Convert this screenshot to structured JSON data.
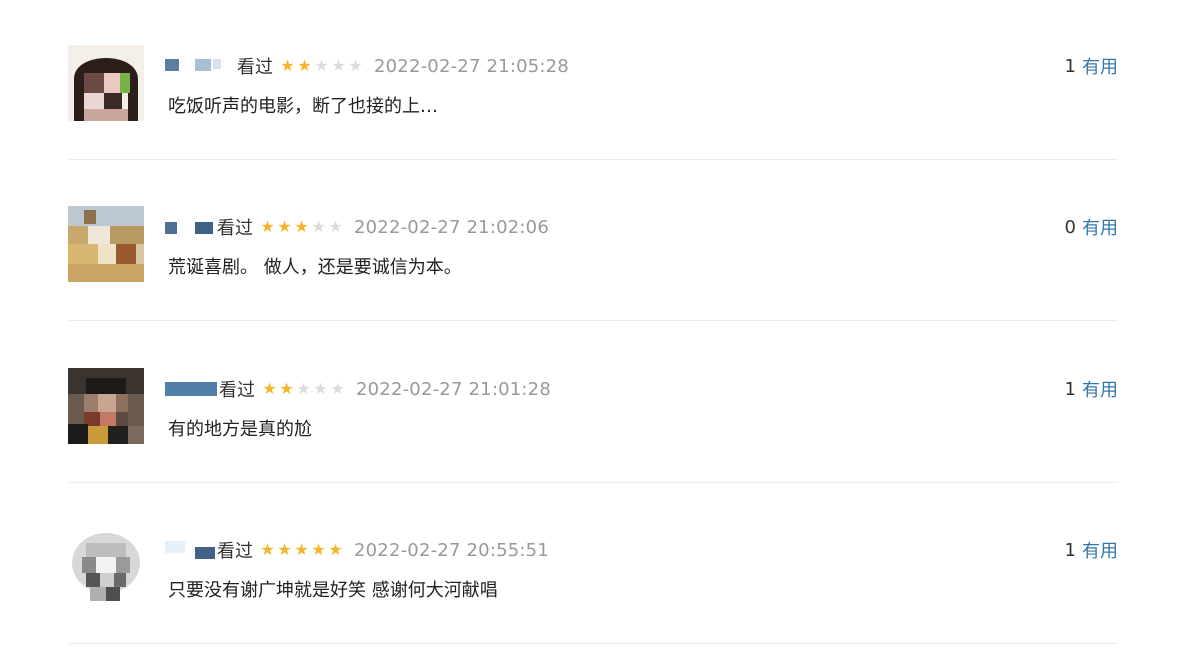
{
  "comments": [
    {
      "status": "看过",
      "rating": 2,
      "time": "2022-02-27 21:05:28",
      "votes": "1",
      "vote_label": "有用",
      "text": "吃饭听声的电影，断了也接的上…"
    },
    {
      "status": "看过",
      "rating": 3,
      "time": "2022-02-27 21:02:06",
      "votes": "0",
      "vote_label": "有用",
      "text": "荒诞喜剧。 做人，还是要诚信为本。"
    },
    {
      "status": "看过",
      "rating": 2,
      "time": "2022-02-27 21:01:28",
      "votes": "1",
      "vote_label": "有用",
      "text": "有的地方是真的尬"
    },
    {
      "status": "看过",
      "rating": 5,
      "time": "2022-02-27 20:55:51",
      "votes": "1",
      "vote_label": "有用",
      "text": "只要没有谢广坤就是好笑 感谢何大河献唱"
    }
  ],
  "colors": {
    "star_on": "#f4b52a",
    "star_off": "#dcdcdc",
    "link": "#3377aa",
    "time": "#999999"
  },
  "icons": {
    "star": "star-icon"
  }
}
